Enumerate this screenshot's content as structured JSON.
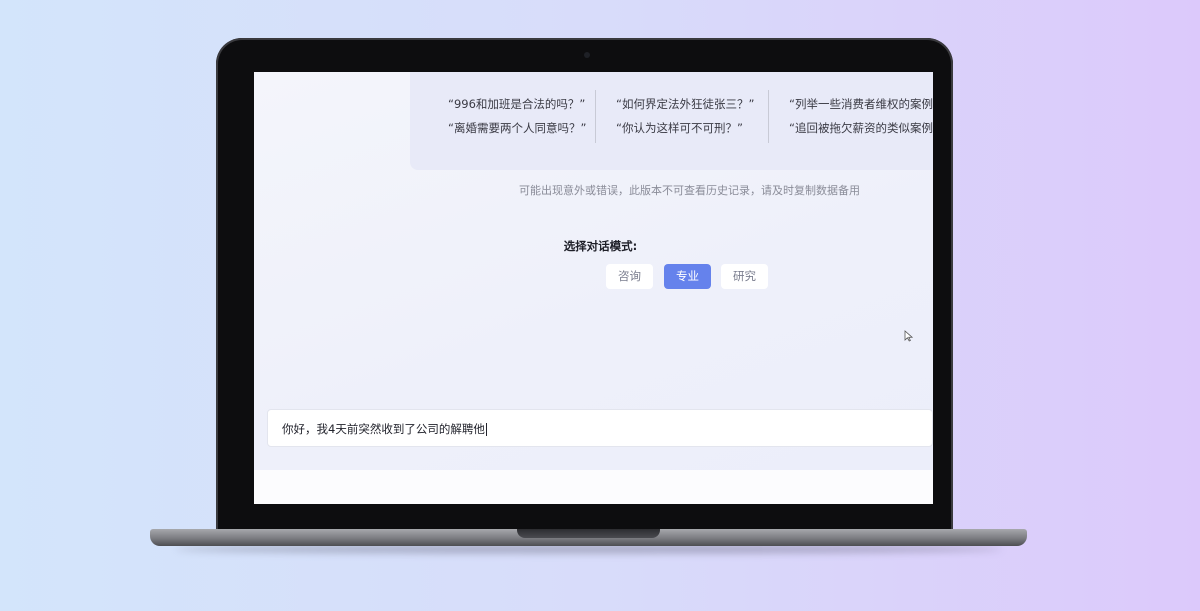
{
  "suggestions": {
    "col1": [
      "“996和加班是合法的吗？”",
      "“离婚需要两个人同意吗？”"
    ],
    "col2": [
      "“如何界定法外狂徒张三？”",
      "“你认为这样可不可刑？”"
    ],
    "col3": [
      "“列举一些消费者维权的案例”",
      "“追回被拖欠薪资的类似案例”"
    ]
  },
  "notice": "可能出现意外或错误，此版本不可查看历史记录，请及时复制数据备用",
  "mode": {
    "title": "选择对话模式:",
    "options": [
      "咨询",
      "专业",
      "研究"
    ],
    "selected": "专业"
  },
  "input": {
    "value": "你好，我4天前突然收到了公司的解聘他"
  },
  "colors": {
    "accent": "#6582ec",
    "background_left": "#d3e5fb",
    "background_right": "#dcc9fb"
  },
  "icons": [
    "mouse-pointer-icon"
  ]
}
